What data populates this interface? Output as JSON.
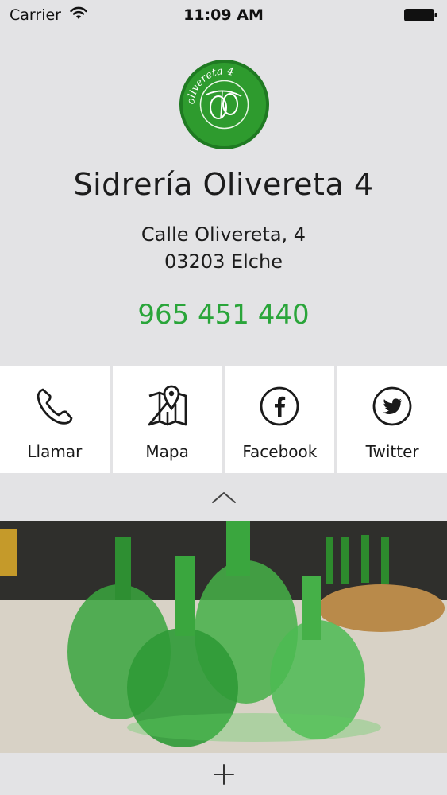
{
  "status_bar": {
    "carrier": "Carrier",
    "time": "11:09 AM"
  },
  "business": {
    "name": "Sidrería Olivereta 4",
    "address_line1": "Calle Olivereta, 4",
    "address_line2": "03203 Elche",
    "phone": "965 451 440",
    "logo_text": "olivereta 4"
  },
  "actions": [
    {
      "label": "Llamar",
      "icon": "phone-icon"
    },
    {
      "label": "Mapa",
      "icon": "map-icon"
    },
    {
      "label": "Facebook",
      "icon": "facebook-icon"
    },
    {
      "label": "Twitter",
      "icon": "twitter-icon"
    }
  ],
  "colors": {
    "accent_green": "#2aa53a",
    "background": "#e3e3e5",
    "tile": "#ffffff"
  },
  "icons": {
    "collapse": "chevron-up-icon",
    "expand": "plus-icon"
  }
}
